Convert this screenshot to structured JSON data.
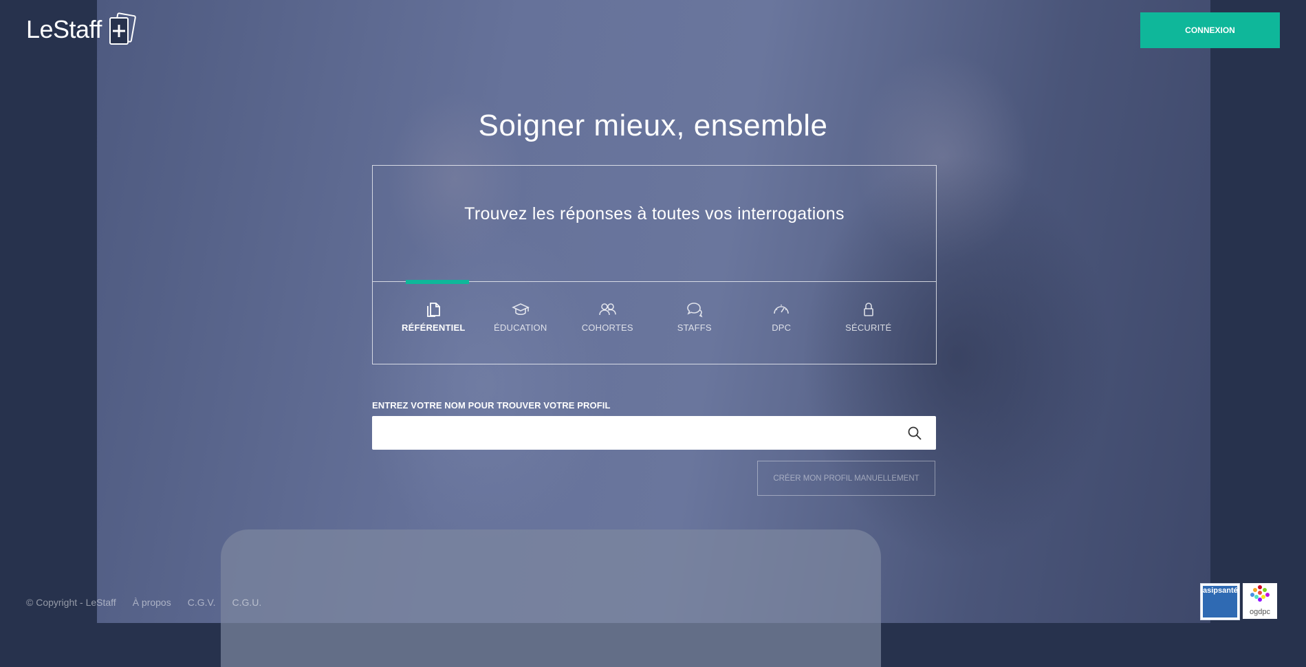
{
  "brand": {
    "name": "LeStaff"
  },
  "header": {
    "login_label": "CONNEXION"
  },
  "hero": {
    "headline": "Soigner mieux, ensemble",
    "subtitle": "Trouvez les réponses à toutes vos interrogations"
  },
  "tabs": [
    {
      "label": "RÉFÉRENTIEL",
      "icon": "document-copy-icon",
      "active": true
    },
    {
      "label": "ÉDUCATION",
      "icon": "graduation-cap-icon",
      "active": false
    },
    {
      "label": "COHORTES",
      "icon": "users-icon",
      "active": false
    },
    {
      "label": "STAFFS",
      "icon": "chat-bubbles-icon",
      "active": false
    },
    {
      "label": "DPC",
      "icon": "speedometer-icon",
      "active": false
    },
    {
      "label": "SÉCURITÉ",
      "icon": "lock-icon",
      "active": false
    }
  ],
  "search": {
    "label": "ENTREZ VOTRE NOM POUR TROUVER VOTRE PROFIL",
    "value": "",
    "placeholder": ""
  },
  "manual_profile_label": "CRÉER MON PROFIL MANUELLEMENT",
  "footer": {
    "copyright": "© Copyright - LeStaff",
    "links": [
      "À propos",
      "C.G.V.",
      "C.G.U."
    ]
  },
  "badges": {
    "asip": "asipsanté",
    "ogdpc": "ogdpc"
  },
  "colors": {
    "accent": "#0fb79a",
    "background": "#27324d"
  }
}
